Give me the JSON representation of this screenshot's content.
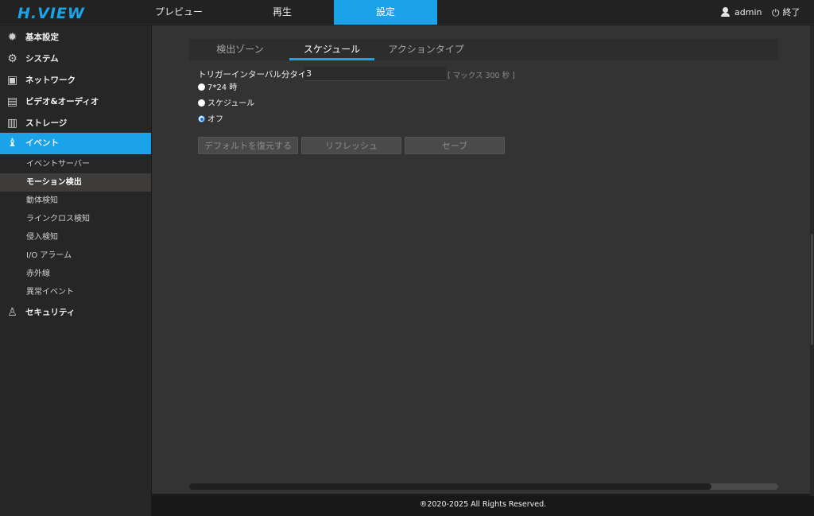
{
  "header": {
    "logo": "H.VIEW",
    "nav": [
      "プレビュー",
      "再生",
      "設定"
    ],
    "active_nav": "設定",
    "user": "admin",
    "logout": "終了"
  },
  "sidebar": {
    "items": [
      {
        "label": "基本設定",
        "icon": "gear-icon"
      },
      {
        "label": "システム",
        "icon": "gears-icon"
      },
      {
        "label": "ネットワーク",
        "icon": "network-icon"
      },
      {
        "label": "ビデオ&オーディオ",
        "icon": "clapperboard-icon"
      },
      {
        "label": "ストレージ",
        "icon": "floppy-disk-icon"
      },
      {
        "label": "イベント",
        "icon": "bell-icon"
      },
      {
        "label": "セキュリティ",
        "icon": "user-security-icon"
      }
    ],
    "active_item": "イベント",
    "sub_items": [
      "イベントサーバー",
      "モーション検出",
      "動体検知",
      "ラインクロス検知",
      "侵入検知",
      "I/O アラーム",
      "赤外線",
      "異常イベント"
    ],
    "active_sub_item": "モーション検出"
  },
  "tabs": [
    "検出ゾーン",
    "スケジュール",
    "アクションタイプ"
  ],
  "active_tab": "スケジュール",
  "form": {
    "interval_label": "トリガーインターバル分タイム",
    "interval_value": "3",
    "interval_hint": "[ マックス 300 秒 ]",
    "radio_options": [
      "7*24 時",
      "スケジュール",
      "オフ"
    ],
    "selected_option": "オフ"
  },
  "buttons": {
    "restore": "デフォルトを復元する",
    "refresh": "リフレッシュ",
    "save": "セーブ"
  },
  "footer": "®2020-2025 All Rights Reserved.",
  "colors": {
    "accent": "#1aa3e8",
    "background": "#333333",
    "sidebar": "#262626"
  }
}
